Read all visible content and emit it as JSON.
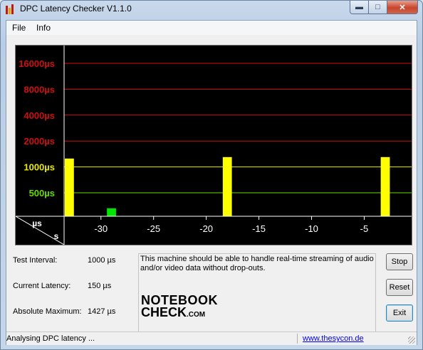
{
  "window": {
    "title": "DPC Latency Checker V1.1.0"
  },
  "menu": {
    "file": "File",
    "info": "Info"
  },
  "chart_data": {
    "type": "bar",
    "y_scale": "log",
    "y_tick_labels": [
      "16000µs",
      "8000µs",
      "4000µs",
      "2000µs",
      "1000µs",
      "500µs"
    ],
    "y_tick_values": [
      16000,
      8000,
      4000,
      2000,
      1000,
      500
    ],
    "y_tick_colors": [
      "#cc1010",
      "#cc1010",
      "#cc1010",
      "#cc1010",
      "#e8e800",
      "#66dd00"
    ],
    "y_unit": "µs",
    "x_unit": "s",
    "x_tick_labels": [
      "-30",
      "-25",
      "-20",
      "-15",
      "-10",
      "-5"
    ],
    "x_tick_values": [
      -30,
      -25,
      -20,
      -15,
      -10,
      -5
    ],
    "x": [
      -33,
      -32,
      -31,
      -30,
      -29,
      -28,
      -27,
      -26,
      -25,
      -24,
      -23,
      -22,
      -21,
      -20,
      -19,
      -18,
      -17,
      -16,
      -15,
      -14,
      -13,
      -12,
      -11,
      -10,
      -9,
      -8,
      -7,
      -6,
      -5,
      -4,
      -3,
      -2,
      -1
    ],
    "values": [
      1250,
      200,
      200,
      200,
      330,
      190,
      200,
      200,
      210,
      200,
      200,
      200,
      200,
      190,
      190,
      1300,
      190,
      190,
      250,
      230,
      200,
      210,
      200,
      200,
      170,
      180,
      200,
      200,
      190,
      240,
      1300,
      200,
      200
    ],
    "bar_colors": {
      "normal": "#00e600",
      "high": "#ffff00"
    },
    "threshold_lines": {
      "red": "#cc1010",
      "yellow": "#e8e800",
      "green": "#66dd00"
    }
  },
  "info": {
    "test_interval_label": "Test Interval:",
    "test_interval_value": "1000 µs",
    "current_latency_label": "Current Latency:",
    "current_latency_value": "150 µs",
    "absolute_max_label": "Absolute Maximum:",
    "absolute_max_value": "1427 µs"
  },
  "message": "This machine should be able to handle real-time streaming of audio and/or video data without drop-outs.",
  "logo": {
    "line1": "NOTEBOOK",
    "line2": "CHECK",
    "suffix": ".COM"
  },
  "buttons": {
    "stop": "Stop",
    "reset": "Reset",
    "exit": "Exit"
  },
  "status": {
    "text": "Analysing DPC latency ...",
    "link": "www.thesycon.de"
  }
}
